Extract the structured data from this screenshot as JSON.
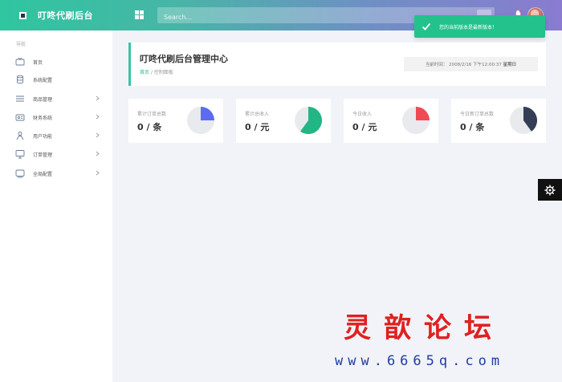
{
  "header": {
    "title": "叮咚代刷后台",
    "search_placeholder": "Search..."
  },
  "toast": {
    "message": "您的当前版本是最新版本！"
  },
  "sidebar": {
    "section_label": "导航",
    "items": [
      {
        "label": "首页",
        "icon": "tv-icon",
        "arrow": false
      },
      {
        "label": "系统配置",
        "icon": "database-icon",
        "arrow": false
      },
      {
        "label": "商品管理",
        "icon": "list-icon",
        "arrow": true
      },
      {
        "label": "财务系统",
        "icon": "card-icon",
        "arrow": true
      },
      {
        "label": "用户功能",
        "icon": "user-icon",
        "arrow": true
      },
      {
        "label": "订单管理",
        "icon": "monitor-icon",
        "arrow": true
      },
      {
        "label": "全局配置",
        "icon": "screen-icon",
        "arrow": true
      }
    ]
  },
  "main": {
    "page_title": "叮咚代刷后台管理中心",
    "breadcrumb_home": "首页",
    "breadcrumb_sep": "/",
    "breadcrumb_current": "控制面板",
    "login_label": "当前时间：",
    "login_value": "2008/2/16 下午12:00:37",
    "login_tail": "星期日"
  },
  "stats": [
    {
      "label": "累计订单总数",
      "value": "0 / 条",
      "color": "#5b6cf0",
      "fraction": 0.25
    },
    {
      "label": "累计总收入",
      "value": "0 / 元",
      "color": "#22b685",
      "fraction": 0.6
    },
    {
      "label": "今日收入",
      "value": "0 / 元",
      "color": "#ee4b55",
      "fraction": 0.25
    },
    {
      "label": "今日新订单总数",
      "value": "0 / 条",
      "color": "#343e54",
      "fraction": 0.4
    }
  ],
  "watermark": {
    "title": "灵歆论坛",
    "url": "www.6665q.com"
  }
}
